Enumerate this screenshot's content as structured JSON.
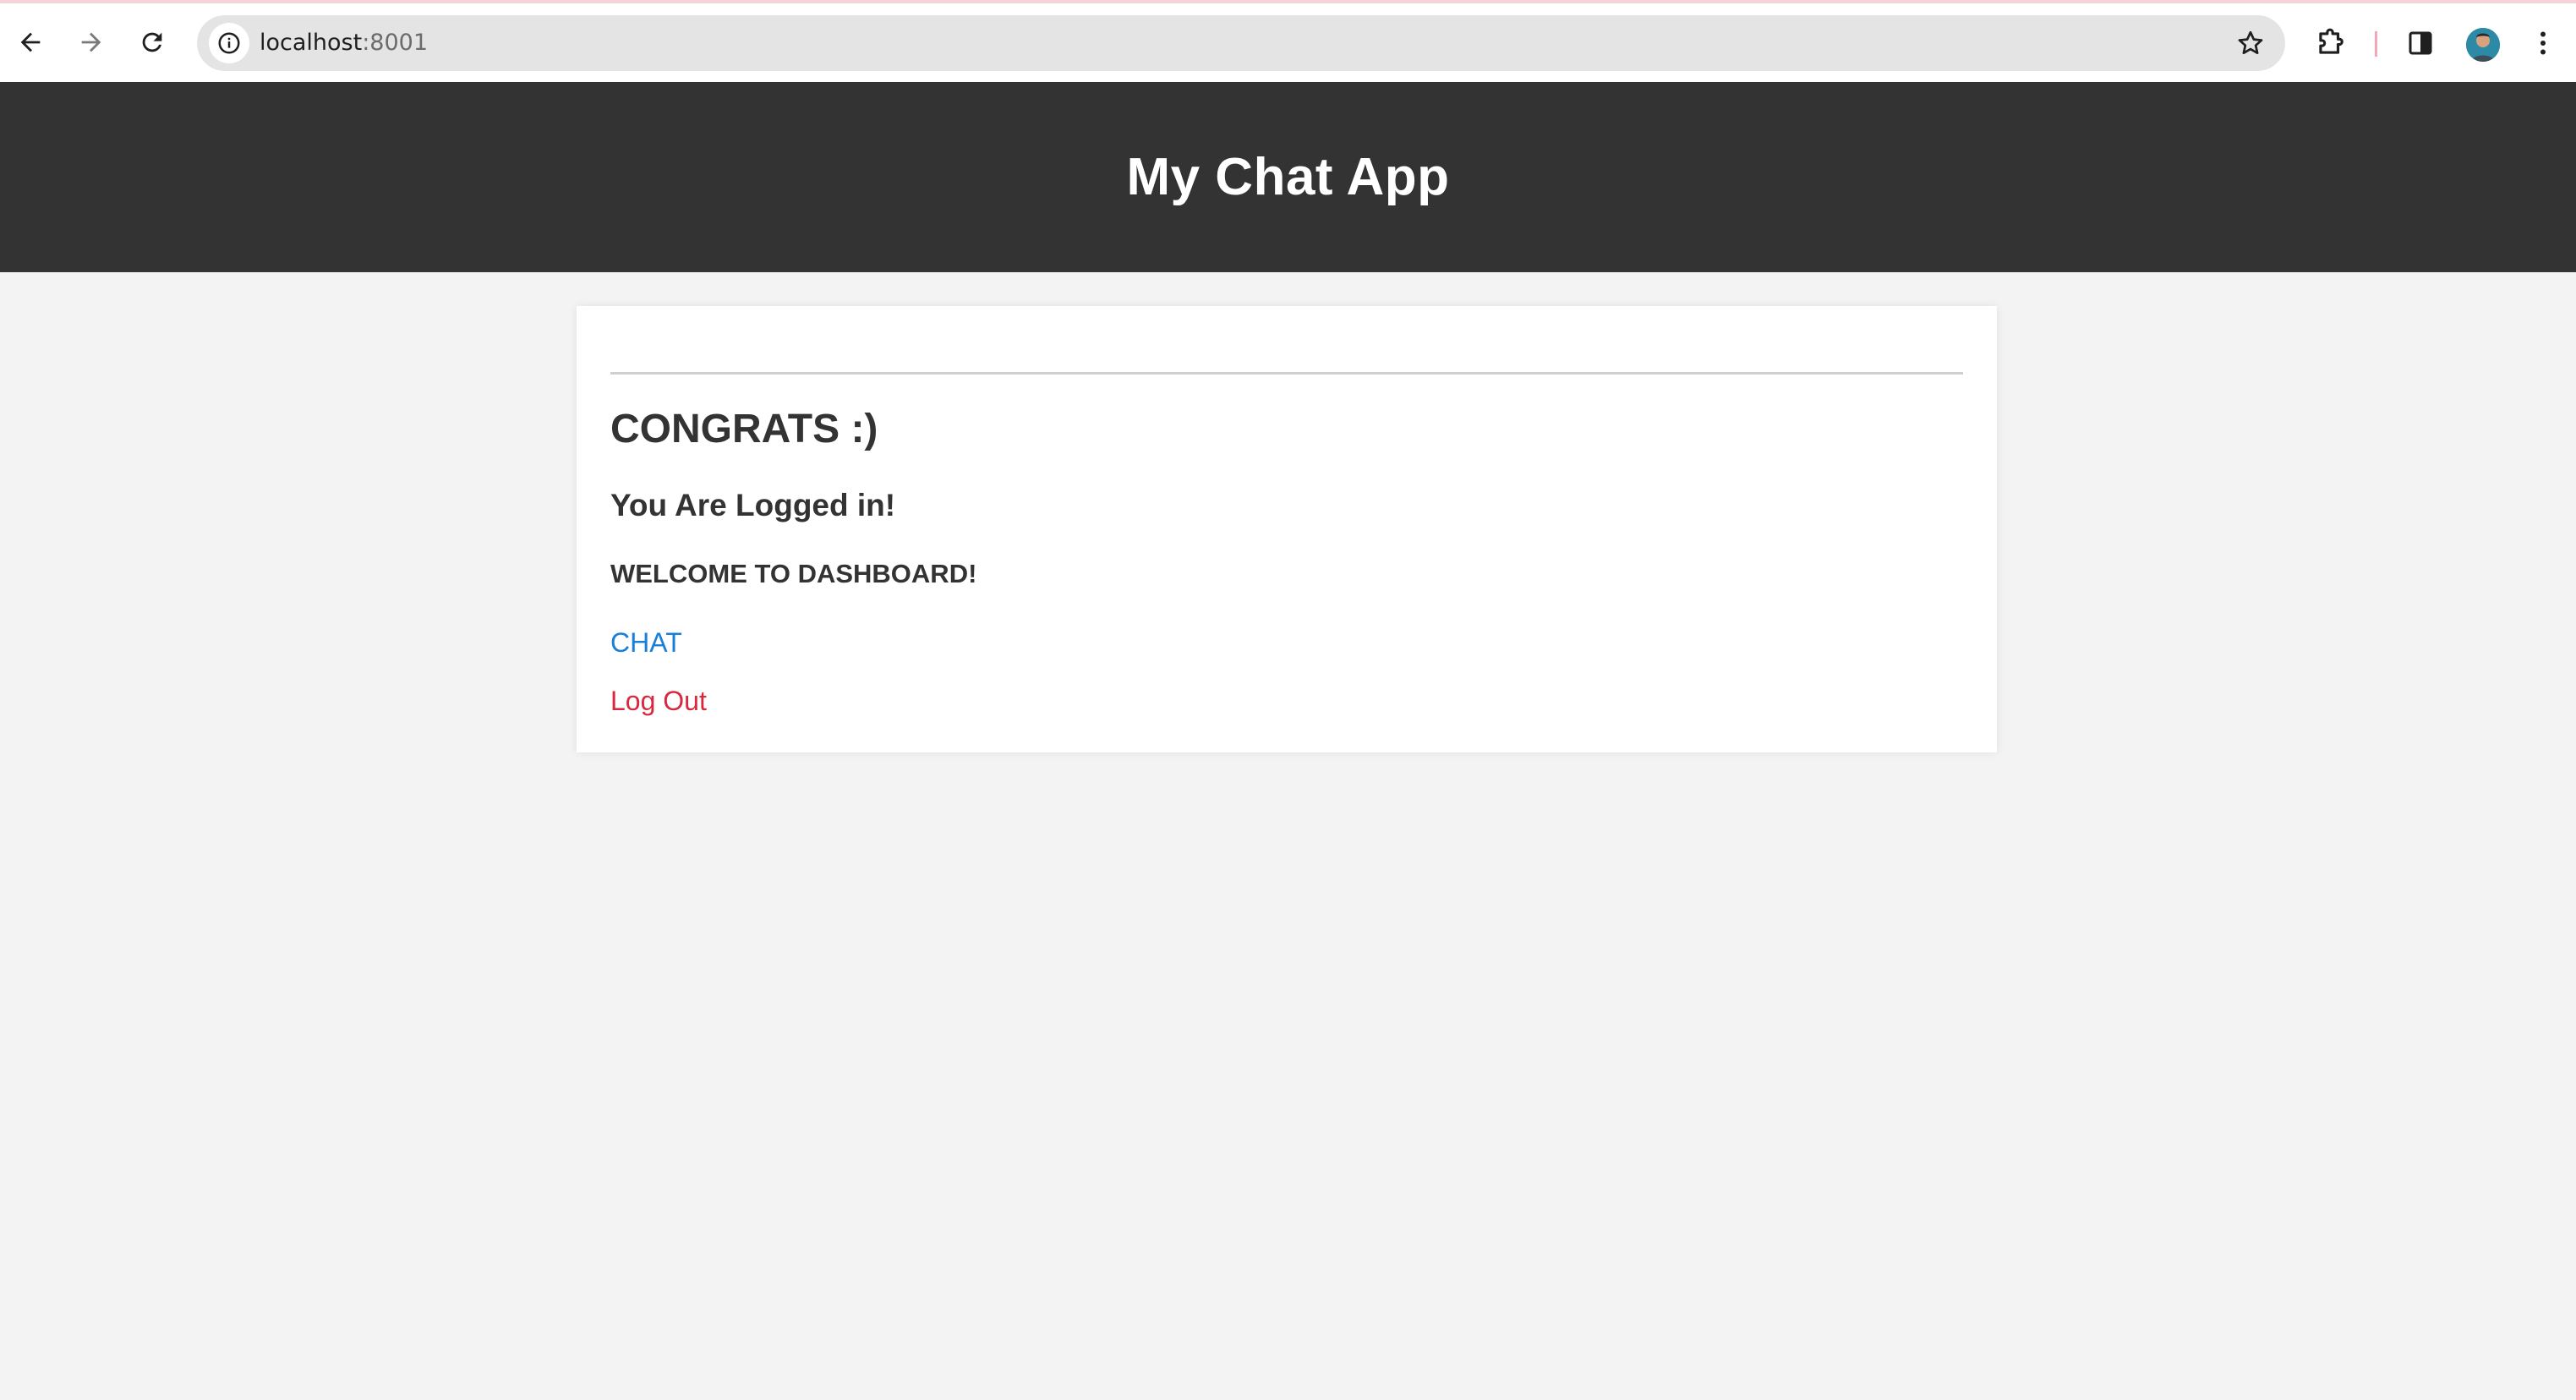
{
  "browser": {
    "url_host": "localhost",
    "url_port": ":8001",
    "icons": {
      "back": "arrow-left-icon",
      "forward": "arrow-right-icon",
      "reload": "reload-icon",
      "site_info": "info-icon",
      "bookmark": "star-icon",
      "extensions": "puzzle-icon",
      "side_panel": "side-panel-icon",
      "profile": "avatar",
      "menu": "kebab-menu-icon"
    }
  },
  "header": {
    "title": "My Chat App",
    "background": "#333333"
  },
  "card": {
    "heading": "CONGRATS :)",
    "subheading": "You Are Logged in!",
    "welcome": "WELCOME TO DASHBOARD!",
    "chat_link": "CHAT",
    "logout_link": "Log Out"
  },
  "colors": {
    "page_background": "#f3f3f3",
    "chat_link": "#1a7fd9",
    "logout_link": "#d9283e",
    "text": "#333333"
  }
}
